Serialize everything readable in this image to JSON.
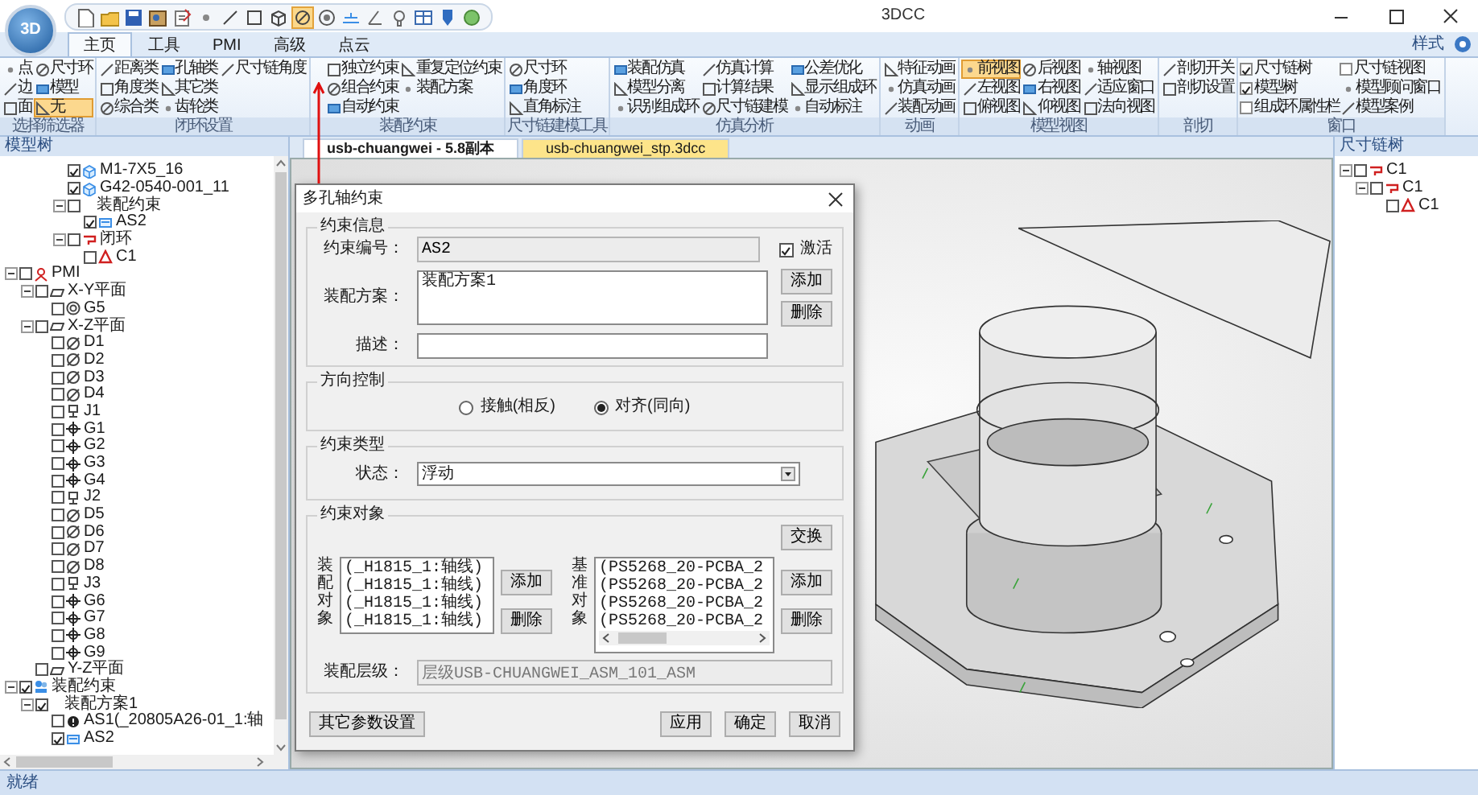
{
  "app": {
    "logo": "3D",
    "title": "3DCC"
  },
  "quick_access": [
    {
      "selected": false
    },
    {
      "selected": false
    },
    {
      "selected": false
    },
    {
      "selected": false
    },
    {
      "selected": false
    },
    {
      "selected": false
    },
    {
      "selected": false
    },
    {
      "selected": false
    },
    {
      "selected": false
    },
    {
      "selected": true
    },
    {
      "selected": false
    },
    {
      "selected": false
    },
    {
      "selected": false
    },
    {
      "selected": false
    },
    {
      "selected": false
    },
    {
      "selected": false
    },
    {
      "selected": false
    }
  ],
  "ribbon": {
    "tabs": [
      {
        "label": "主页",
        "selected": true
      },
      {
        "label": "工具",
        "selected": false
      },
      {
        "label": "PMI",
        "selected": false
      },
      {
        "label": "高级",
        "selected": false
      },
      {
        "label": "点云",
        "selected": false
      }
    ],
    "style_menu": "样式",
    "groups": [
      {
        "label": "选择筛选器",
        "columns": [
          [
            {
              "kind": "button",
              "label": "点",
              "selected": false
            },
            {
              "kind": "button",
              "label": "边",
              "selected": false
            },
            {
              "kind": "button",
              "label": "面",
              "selected": false
            }
          ],
          [
            {
              "kind": "button",
              "label": "尺寸环",
              "selected": false
            },
            {
              "kind": "button",
              "label": "模型",
              "selected": false
            },
            {
              "kind": "button",
              "label": "无",
              "selected": true
            }
          ]
        ]
      },
      {
        "label": "闭环设置",
        "columns": [
          [
            {
              "kind": "button",
              "label": "距离类"
            },
            {
              "kind": "button",
              "label": "角度类"
            },
            {
              "kind": "button",
              "label": "综合类"
            }
          ],
          [
            {
              "kind": "button",
              "label": "孔轴类"
            },
            {
              "kind": "button",
              "label": "其它类"
            },
            {
              "kind": "button",
              "label": "齿轮类"
            }
          ],
          [
            {
              "kind": "button",
              "label": "尺寸链角度"
            }
          ]
        ]
      },
      {
        "label": "装配约束",
        "columns": [
          [
            {
              "kind": "button",
              "label": "独立约束"
            },
            {
              "kind": "button",
              "label": "组合约束"
            },
            {
              "kind": "button",
              "label": "自动约束"
            }
          ],
          [
            {
              "kind": "button",
              "label": "重复定位约束"
            },
            {
              "kind": "button",
              "label": "装配方案"
            }
          ]
        ]
      },
      {
        "label": "尺寸链建模工具",
        "columns": [
          [
            {
              "kind": "button",
              "label": "尺寸环"
            },
            {
              "kind": "button",
              "label": "角度环"
            },
            {
              "kind": "button",
              "label": "直角标注"
            }
          ]
        ]
      },
      {
        "label": "仿真分析",
        "columns": [
          [
            {
              "kind": "button",
              "label": "装配仿真"
            },
            {
              "kind": "button",
              "label": "模型分离"
            },
            {
              "kind": "button",
              "label": "识别组成环"
            }
          ],
          [
            {
              "kind": "button",
              "label": "仿真计算"
            },
            {
              "kind": "button",
              "label": "计算结果"
            },
            {
              "kind": "button",
              "label": "尺寸链建模"
            }
          ],
          [
            {
              "kind": "button",
              "label": "公差优化"
            },
            {
              "kind": "button",
              "label": "显示组成环"
            },
            {
              "kind": "button",
              "label": "自动标注"
            }
          ]
        ]
      },
      {
        "label": "动画",
        "columns": [
          [
            {
              "kind": "button",
              "label": "特征动画"
            },
            {
              "kind": "button",
              "label": "仿真动画"
            },
            {
              "kind": "button",
              "label": "装配动画"
            }
          ]
        ]
      },
      {
        "label": "模型视图",
        "columns": [
          [
            {
              "kind": "button",
              "label": "前视图",
              "selected": true
            },
            {
              "kind": "button",
              "label": "左视图",
              "selected": false
            },
            {
              "kind": "button",
              "label": "俯视图",
              "selected": false
            }
          ],
          [
            {
              "kind": "button",
              "label": "后视图",
              "selected": false
            },
            {
              "kind": "button",
              "label": "右视图",
              "selected": false
            },
            {
              "kind": "button",
              "label": "仰视图",
              "selected": false
            }
          ],
          [
            {
              "kind": "button",
              "label": "轴视图",
              "selected": false
            },
            {
              "kind": "button",
              "label": "适应窗口",
              "selected": false
            },
            {
              "kind": "button",
              "label": "法向视图",
              "selected": false
            }
          ]
        ]
      },
      {
        "label": "剖切",
        "columns": [
          [
            {
              "kind": "button",
              "label": "剖切开关"
            },
            {
              "kind": "button",
              "label": "剖切设置"
            }
          ]
        ]
      },
      {
        "label": "窗口",
        "columns": [
          [
            {
              "kind": "check",
              "label": "尺寸链树",
              "checked": true
            },
            {
              "kind": "check",
              "label": "模型树",
              "checked": true
            },
            {
              "kind": "check",
              "label": "组成环属性栏",
              "checked": false
            }
          ],
          [
            {
              "kind": "check",
              "label": "尺寸链视图",
              "checked": false
            },
            {
              "kind": "button",
              "label": "模型顾问窗口"
            },
            {
              "kind": "button",
              "label": "模型案例"
            }
          ]
        ]
      }
    ]
  },
  "model_tree": {
    "title": "模型树",
    "scrolled_branch": [
      {
        "label": "M1-7X5_16",
        "kind": "part",
        "checked": true
      },
      {
        "label": "G42-0540-001_11",
        "kind": "part",
        "checked": true
      },
      {
        "label": "装配约束",
        "kind": "plain",
        "checked": false,
        "expanded": true,
        "children": [
          {
            "label": "AS2",
            "kind": "constraint",
            "checked": true
          }
        ]
      },
      {
        "label": "闭环",
        "kind": "loop",
        "checked": false,
        "expanded": true,
        "children": [
          {
            "label": "C1",
            "kind": "chain",
            "checked": false
          }
        ]
      }
    ],
    "items": [
      {
        "label": "PMI",
        "kind": "pmi",
        "checked": false,
        "expanded": true,
        "children": [
          {
            "label": "X-Y平面",
            "kind": "plane",
            "checked": false,
            "expanded": true,
            "children": [
              {
                "label": "G5",
                "kind": "concentric",
                "checked": false
              }
            ]
          },
          {
            "label": "X-Z平面",
            "kind": "plane",
            "checked": false,
            "expanded": true,
            "children": [
              {
                "label": "D1",
                "kind": "diameter",
                "checked": false
              },
              {
                "label": "D2",
                "kind": "diameter",
                "checked": false
              },
              {
                "label": "D3",
                "kind": "diameter",
                "checked": false
              },
              {
                "label": "D4",
                "kind": "diameter",
                "checked": false
              },
              {
                "label": "J1",
                "kind": "datum",
                "checked": false
              },
              {
                "label": "G1",
                "kind": "position",
                "checked": false
              },
              {
                "label": "G2",
                "kind": "position",
                "checked": false
              },
              {
                "label": "G3",
                "kind": "position",
                "checked": false
              },
              {
                "label": "G4",
                "kind": "position",
                "checked": false
              },
              {
                "label": "J2",
                "kind": "datum",
                "checked": false
              },
              {
                "label": "D5",
                "kind": "diameter",
                "checked": false
              },
              {
                "label": "D6",
                "kind": "diameter",
                "checked": false
              },
              {
                "label": "D7",
                "kind": "diameter",
                "checked": false
              },
              {
                "label": "D8",
                "kind": "diameter",
                "checked": false
              },
              {
                "label": "J3",
                "kind": "datum",
                "checked": false
              },
              {
                "label": "G6",
                "kind": "position",
                "checked": false
              },
              {
                "label": "G7",
                "kind": "position",
                "checked": false
              },
              {
                "label": "G8",
                "kind": "position",
                "checked": false
              },
              {
                "label": "G9",
                "kind": "position",
                "checked": false
              }
            ]
          },
          {
            "label": "Y-Z平面",
            "kind": "plane",
            "checked": false
          }
        ]
      },
      {
        "label": "装配约束",
        "kind": "assembly",
        "checked": true,
        "expanded": true,
        "children": [
          {
            "label": "装配方案1",
            "kind": "plain",
            "checked": true,
            "expanded": true,
            "children": [
              {
                "label": "AS1(_20805A26-01_1:轴",
                "kind": "alert",
                "checked": false
              },
              {
                "label": "AS2",
                "kind": "constraint",
                "checked": true
              }
            ]
          }
        ]
      }
    ]
  },
  "document_tabs": [
    {
      "label": "usb-chuangwei - 5.8副本",
      "selected": true
    },
    {
      "label": "usb-chuangwei_stp.3dcc",
      "selected": false
    }
  ],
  "chain_tree": {
    "title": "尺寸链树",
    "items": [
      {
        "label": "C1",
        "kind": "loop",
        "checked": false,
        "expanded": true,
        "children": [
          {
            "label": "C1",
            "kind": "loop",
            "checked": false,
            "expanded": true,
            "children": [
              {
                "label": "C1",
                "kind": "chain",
                "checked": false
              }
            ]
          }
        ]
      }
    ]
  },
  "dialog": {
    "title": "多孔轴约束",
    "info": {
      "legend": "约束信息",
      "id_label": "约束编号：",
      "id_value": "AS2",
      "active": {
        "label": "激活",
        "checked": true
      },
      "scheme_label": "装配方案：",
      "scheme_value": "装配方案1",
      "add": "添加",
      "delete": "删除",
      "desc_label": "描述："
    },
    "direction": {
      "legend": "方向控制",
      "options": [
        {
          "label": "接触(相反)",
          "selected": false
        },
        {
          "label": "对齐(同向)",
          "selected": true
        }
      ]
    },
    "type": {
      "legend": "约束类型",
      "state_label": "状态：",
      "state_value": "浮动"
    },
    "objects": {
      "legend": "约束对象",
      "swap": "交换",
      "assembly_label": "装配对象",
      "assembly_items": [
        "(_H1815_1:轴线)",
        "(_H1815_1:轴线)",
        "(_H1815_1:轴线)",
        "(_H1815_1:轴线)"
      ],
      "assembly_add": "添加",
      "assembly_delete": "删除",
      "base_label": "基准对象",
      "base_items": [
        "(PS5268_20-PCBA_2",
        "(PS5268_20-PCBA_2",
        "(PS5268_20-PCBA_2",
        "(PS5268_20-PCBA_2"
      ],
      "base_add": "添加",
      "base_delete": "删除",
      "level_label": "装配层级：",
      "level_value": "层级USB-CHUANGWEI_ASM_101_ASM"
    },
    "buttons": [
      "其它参数设置",
      "应用",
      "确定",
      "取消"
    ]
  },
  "status_bar": "就绪"
}
